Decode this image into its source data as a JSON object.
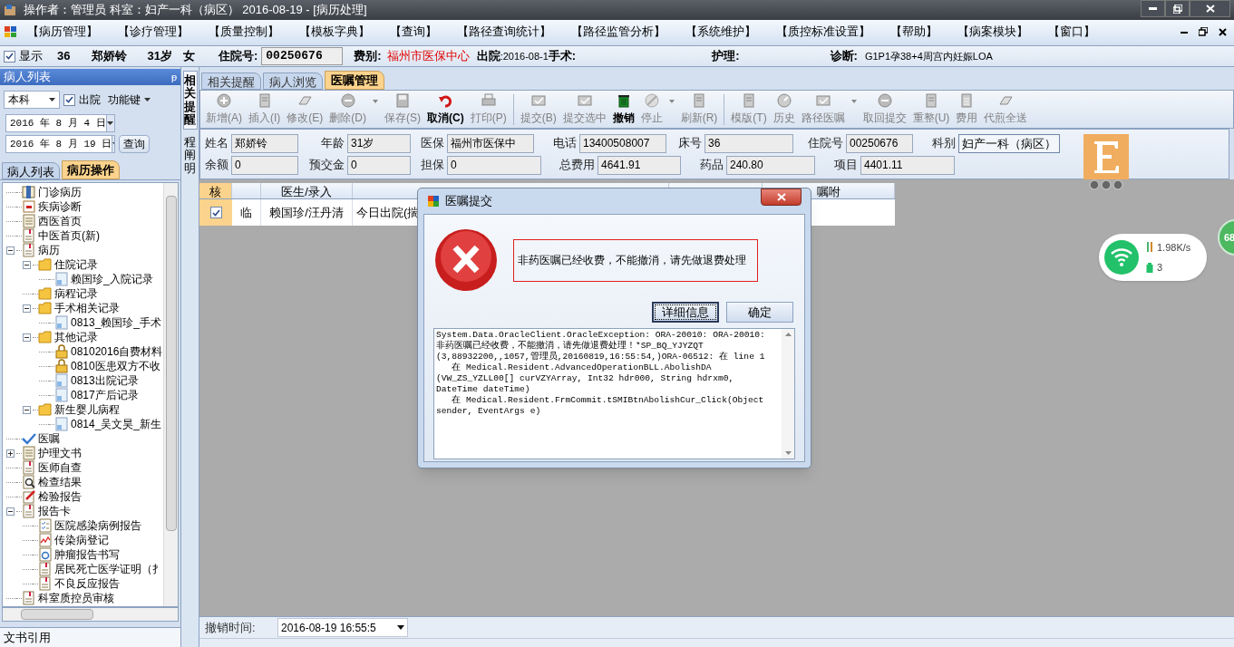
{
  "window": {
    "title": "操作者：管理员  科室：妇产一科（病区）  2016-08-19 - [病历处理]"
  },
  "menu": [
    "【病历管理】",
    "【诊疗管理】",
    "【质量控制】",
    "【模板字典】",
    "【查询】",
    "【路径查询统计】",
    "【路径监管分析】",
    "【系统维护】",
    "【质控标准设置】",
    "【帮助】",
    "【病案模块】",
    "【窗口】"
  ],
  "patient_bar": {
    "show_label": "显示",
    "show_checked": true,
    "bed": "36",
    "name": "郑娇铃",
    "age": "31岁",
    "sex": "女",
    "admission_label": "住院号:",
    "admission_no": "00250676",
    "fee_label": "费别:",
    "fee_value": "福州市医保中心",
    "discharge_label": "出院",
    "discharge_value": ":2016-08-1",
    "surgery_label": "手术:",
    "nursing_label": "护理:",
    "diagnosis_label": "诊断:",
    "diagnosis_value": "G1P1孕38+4周宫内妊娠LOA"
  },
  "left_panel": {
    "title": "病人列表",
    "pin": "ᵽ",
    "scope": "本科",
    "discharged_label": "出院",
    "discharged_checked": true,
    "function_label": "功能键",
    "date_from": "2016 年 8 月 4 日",
    "date_to": "2016 年 8 月 19 日",
    "query_button": "查询",
    "tabs": [
      {
        "label": "病人列表",
        "selected": false
      },
      {
        "label": "病历操作",
        "selected": true
      }
    ],
    "tree": [
      {
        "label": "门诊病历",
        "kind": "book"
      },
      {
        "label": "疾病诊断",
        "kind": "calendar"
      },
      {
        "label": "西医首页",
        "kind": "list"
      },
      {
        "label": "中医首页(新)",
        "kind": "doc"
      },
      {
        "label": "病历",
        "kind": "doc",
        "expanded": true,
        "children": [
          {
            "label": "住院记录",
            "kind": "folder",
            "expanded": true,
            "children": [
              {
                "label": "赖国珍_入院记录",
                "kind": "page"
              }
            ]
          },
          {
            "label": "病程记录",
            "kind": "folder"
          },
          {
            "label": "手术相关记录",
            "kind": "folder",
            "expanded": true,
            "children": [
              {
                "label": "0813_赖国珍_手术",
                "kind": "page"
              }
            ]
          },
          {
            "label": "其他记录",
            "kind": "folder",
            "expanded": true,
            "children": [
              {
                "label": "08102016自费材料",
                "kind": "lock"
              },
              {
                "label": "0810医患双方不收",
                "kind": "lock"
              },
              {
                "label": "0813出院记录",
                "kind": "page"
              },
              {
                "label": "0817产后记录",
                "kind": "page"
              }
            ]
          },
          {
            "label": "新生婴儿病程",
            "kind": "folder",
            "expanded": true,
            "children": [
              {
                "label": "0814_吴文昊_新生",
                "kind": "page"
              }
            ]
          }
        ]
      },
      {
        "label": "医嘱",
        "kind": "check"
      },
      {
        "label": "护理文书",
        "kind": "list",
        "expanded": false
      },
      {
        "label": "医师自查",
        "kind": "doc"
      },
      {
        "label": "检查结果",
        "kind": "search"
      },
      {
        "label": "检验报告",
        "kind": "pen"
      },
      {
        "label": "报告卡",
        "kind": "doc",
        "expanded": true,
        "children": [
          {
            "label": "医院感染病例报告",
            "kind": "checklist"
          },
          {
            "label": "传染病登记",
            "kind": "chart"
          },
          {
            "label": "肿瘤报告书写",
            "kind": "target"
          },
          {
            "label": "居民死亡医学证明（扌",
            "kind": "doc"
          },
          {
            "label": "不良反应报告",
            "kind": "doc"
          }
        ]
      },
      {
        "label": "科室质控员审核",
        "kind": "doc"
      }
    ],
    "footer": "文书引用"
  },
  "side_tabs": [
    {
      "label": "相关提醒",
      "selected": true
    },
    {
      "label": "程阐明",
      "selected": false
    }
  ],
  "tabs": [
    {
      "label": "相关提醒",
      "selected": false
    },
    {
      "label": "病人浏览",
      "selected": false
    },
    {
      "label": "医嘱管理",
      "selected": true
    }
  ],
  "toolbar": [
    {
      "label": "新增(A)",
      "kind": "plus",
      "disabled": true,
      "dropdown": false
    },
    {
      "label": "插入(I)",
      "kind": "pages",
      "disabled": true,
      "dropdown": false
    },
    {
      "label": "修改(E)",
      "kind": "eraser",
      "disabled": true,
      "dropdown": false
    },
    {
      "label": "删除(D)",
      "kind": "minus",
      "disabled": true,
      "dropdown": true
    },
    {
      "label": "保存(S)",
      "kind": "disk",
      "disabled": true,
      "dropdown": false
    },
    {
      "label": "取消(C)",
      "kind": "undo",
      "disabled": false,
      "dropdown": false
    },
    {
      "label": "打印(P)",
      "kind": "printer",
      "disabled": true,
      "dropdown": false
    },
    {
      "label": "提交(B)",
      "kind": "mail",
      "disabled": true,
      "dropdown": false
    },
    {
      "label": "提交选中",
      "kind": "mail",
      "disabled": true,
      "dropdown": false
    },
    {
      "label": "撤销",
      "kind": "trash",
      "disabled": false,
      "dropdown": false
    },
    {
      "label": "停止",
      "kind": "stop",
      "disabled": true,
      "dropdown": true
    },
    {
      "label": "刷新(R)",
      "kind": "pages",
      "disabled": true,
      "dropdown": false
    },
    {
      "label": "模版(T)",
      "kind": "pages",
      "disabled": true,
      "dropdown": false
    },
    {
      "label": "历史",
      "kind": "clock",
      "disabled": true,
      "dropdown": false
    },
    {
      "label": "路径医嘱",
      "kind": "mail",
      "disabled": true,
      "dropdown": true
    },
    {
      "label": "取回提交",
      "kind": "minus",
      "disabled": true,
      "dropdown": false
    },
    {
      "label": "重整(U)",
      "kind": "pages",
      "disabled": true,
      "dropdown": false
    },
    {
      "label": "费用",
      "kind": "calc",
      "disabled": true,
      "dropdown": false
    },
    {
      "label": "代煎全送",
      "kind": "eraser",
      "disabled": true,
      "dropdown": false
    }
  ],
  "info_form": [
    [
      {
        "label": "姓名",
        "value": "郑娇铃"
      },
      {
        "label": "年龄",
        "value": "31岁"
      },
      {
        "label": "医保",
        "value": "福州市医保中"
      },
      {
        "label": "电话",
        "value": "13400508007"
      },
      {
        "label": "床号",
        "value": "36"
      },
      {
        "label": "住院号",
        "value": "00250676"
      },
      {
        "label": "科别",
        "value": "妇产一科（病区）"
      }
    ],
    [
      {
        "label": "余额",
        "value": "0"
      },
      {
        "label": "预交金",
        "value": "0"
      },
      {
        "label": "担保",
        "value": "0"
      },
      {
        "label": "总费用",
        "value": "4641.91"
      },
      {
        "label": "药品",
        "value": "240.80"
      },
      {
        "label": "项目",
        "value": "4401.11"
      }
    ]
  ],
  "orders_table": {
    "columns": [
      "核",
      "",
      "医生/录入",
      "",
      "",
      "嘱咐"
    ],
    "rows": [
      {
        "checked": true,
        "type": "临",
        "doctor": "赖国珍/汪丹清",
        "content": "今日出院(揣"
      }
    ]
  },
  "cancel_time": {
    "label": "撤销时间:",
    "value": "2016-08-19 16:55:5"
  },
  "dialog": {
    "title": "医嘱提交",
    "message": "非药医嘱已经收费，不能撤消，请先做退费处理",
    "buttons": [
      {
        "label": "详细信息",
        "selected": true
      },
      {
        "label": "确定",
        "selected": false
      }
    ],
    "details": [
      "System.Data.OracleClient.OracleException: ORA-20010: ORA-20010:",
      "非药医嘱已经收费，不能撤消，请先做退费处理！*SP_BQ_YJYZQT",
      "(3,88932200,,1057,管理员,20160819,16:55:54,)ORA-06512: 在 line 1",
      "   在 Medical.Resident.AdvancedOperationBLL.AbolishDA",
      "(VW_ZS_YZLL00[] curVZYArray, Int32 hdr000, String hdrxm0,",
      "DateTime dateTime)",
      "   在 Medical.Resident.FrmCommit.tSMIBtnAbolishCur_Click(Object",
      "sender, EventArgs e)"
    ]
  },
  "network_widget": {
    "speed": "1.98K/s",
    "count": "3"
  },
  "float_badge": "68"
}
